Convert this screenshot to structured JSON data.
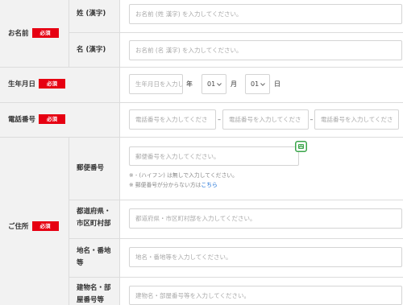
{
  "colors": {
    "required_badge": "#e60012",
    "label_background": "#f2f2f2",
    "link": "#1a6fd6",
    "autofill_icon": "#3aa54a"
  },
  "icons": {
    "autofill": "autofill-icon",
    "select": "chevron-down-icon"
  },
  "fields": {
    "name": {
      "label": "お名前",
      "required_badge": "必須",
      "last_name": {
        "label": "姓 (漢字)",
        "placeholder": "お名前 (姓 漢字) を入力してください。"
      },
      "first_name": {
        "label": "名 (漢字)",
        "placeholder": "お名前 (名 漢字) を入力してください。"
      }
    },
    "birthday": {
      "label": "生年月日",
      "required_badge": "必須",
      "year_placeholder": "生年月日を入力し",
      "year_unit": "年",
      "month_value": "01",
      "month_unit": "月",
      "day_value": "01",
      "day_unit": "日"
    },
    "phone": {
      "label": "電話番号",
      "required_badge": "必須",
      "parts": [
        {
          "placeholder": "電話番号を入力してくださ"
        },
        {
          "placeholder": "電話番号を入力してくださ"
        },
        {
          "placeholder": "電話番号を入力してくださ"
        }
      ],
      "separators": [
        "–",
        "–"
      ]
    },
    "address": {
      "label": "ご住所",
      "required_badge": "必須",
      "postal_code": {
        "label": "郵便番号",
        "placeholder": "郵便番号を入力してください。",
        "hint": "※ - (ハイフン) は無しで入力してください。",
        "lookup_text": "※ 郵便番号が分からない方は",
        "lookup_link": "こちら"
      },
      "prefecture_city": {
        "label": "都道府県・市区町村部",
        "placeholder": "都道府県・市区町村部を入力してください。"
      },
      "street": {
        "label": "地名・番地等",
        "placeholder": "地名・番地等を入力してください。"
      },
      "building": {
        "label": "建物名・部屋番号等",
        "placeholder": "建物名・部屋番号等を入力してください。"
      }
    }
  }
}
